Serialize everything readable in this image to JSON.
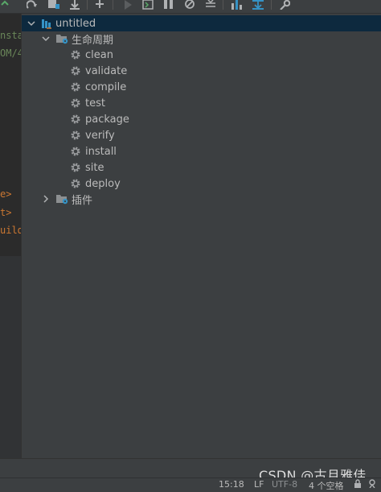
{
  "toolbar": {
    "icons": [
      "refresh-icon",
      "add-maven-projects-icon",
      "download-icon",
      "add-icon",
      "run-icon",
      "execute-goal-icon",
      "toggle-offline-icon",
      "skip-tests-icon",
      "collapse-all-icon",
      "show-dependencies-icon",
      "diagram-icon",
      "settings-wrench-icon"
    ]
  },
  "editor_strip": {
    "lines": [
      "nsta",
      "OM/4",
      "e>",
      "t>",
      "uild"
    ]
  },
  "tree": {
    "root": {
      "label": "untitled",
      "expanded": true
    },
    "lifecycle": {
      "label": "生命周期",
      "expanded": true
    },
    "goals": [
      "clean",
      "validate",
      "compile",
      "test",
      "package",
      "verify",
      "install",
      "site",
      "deploy"
    ],
    "plugins": {
      "label": "插件",
      "expanded": false
    }
  },
  "status_bar": {
    "time": "15:18",
    "line_separator": "LF",
    "encoding": "UTF-8",
    "indent": "4 个空格"
  },
  "watermark": "CSDN @古月雅佳",
  "colors": {
    "panel_bg": "#3c3f41",
    "editor_bg": "#2b2b2b",
    "selection_bg": "#0d293e",
    "text": "#bbbbbb",
    "accent_blue": "#3592c4",
    "accent_green": "#59a869",
    "code_orange": "#cc7832",
    "code_green": "#6a8759"
  }
}
